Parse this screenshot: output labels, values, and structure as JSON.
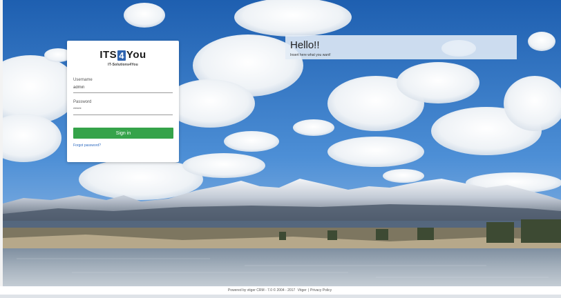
{
  "login": {
    "logo_prefix": "ITS",
    "logo_mid": "4",
    "logo_suffix": "You",
    "logo_tagline": "IT-Solutions4You",
    "username_label": "Username",
    "username_value": "admin",
    "password_label": "Password",
    "password_value": "*****",
    "signin_label": "Sign in",
    "forgot_label": "Forgot password?"
  },
  "banner": {
    "title": "Hello!!",
    "subtitle": "Insert here what you want!"
  },
  "footer": {
    "powered_text": "Powered by vtiger CRM - 7.0  © 2004 - 2017",
    "vtiger_link": "Vtiger",
    "separator": "|",
    "privacy_link": "Privacy Policy"
  },
  "colors": {
    "signin_button": "#35a34a",
    "link": "#2f6bc0",
    "logo_accent": "#2f64b0"
  }
}
